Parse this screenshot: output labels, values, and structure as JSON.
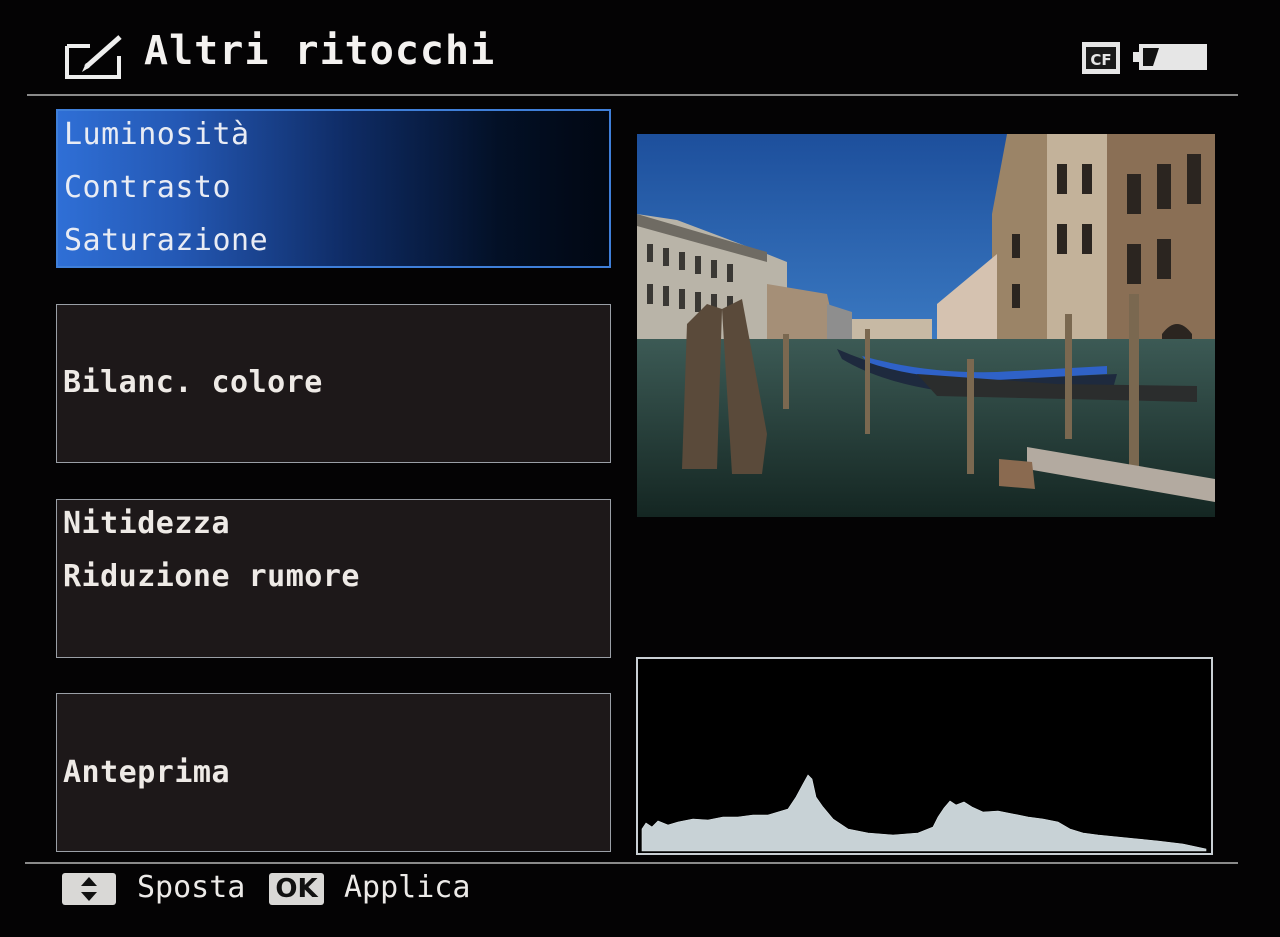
{
  "header": {
    "title": "Altri ritocchi",
    "title_icon": "retouch-edit-icon",
    "card_icon": "cf-card-icon",
    "card_label": "CF",
    "battery_icon": "battery-icon"
  },
  "menu": {
    "selected_index": 0,
    "panels": [
      {
        "lines": [
          "Luminosità",
          "Contrasto",
          "Saturazione"
        ]
      },
      {
        "lines": [
          "Bilanc. colore"
        ]
      },
      {
        "lines": [
          "Nitidezza",
          "Riduzione rumore"
        ]
      },
      {
        "lines": [
          "Anteprima"
        ]
      }
    ]
  },
  "footer": {
    "move_icon": "up-down-arrows-icon",
    "move_label": "Sposta",
    "ok_key": "OK",
    "apply_label": "Applica"
  },
  "colors": {
    "selection": "#2f6fd6",
    "background": "#040304",
    "panel": "#1d1819"
  }
}
